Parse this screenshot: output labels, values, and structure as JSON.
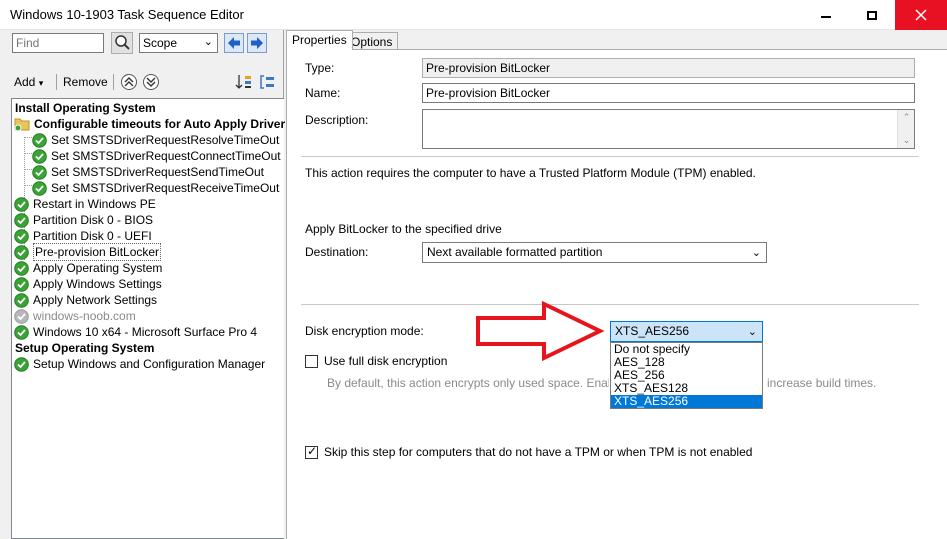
{
  "window": {
    "title": "Windows 10-1903 Task Sequence Editor"
  },
  "search": {
    "find_placeholder": "Find",
    "scope_value": "Scope"
  },
  "toolbar": {
    "add_label": "Add",
    "remove_label": "Remove"
  },
  "tree": {
    "items": [
      {
        "label": "Install Operating System",
        "style": "bold",
        "icon": "none"
      },
      {
        "label": "Configurable timeouts for Auto Apply Driver",
        "style": "bold",
        "icon": "folder"
      },
      {
        "label": "Set SMSTSDriverRequestResolveTimeOut",
        "style": "normal",
        "icon": "check"
      },
      {
        "label": "Set SMSTSDriverRequestConnectTimeOut",
        "style": "normal",
        "icon": "check"
      },
      {
        "label": "Set SMSTSDriverRequestSendTimeOut",
        "style": "normal",
        "icon": "check"
      },
      {
        "label": "Set SMSTSDriverRequestReceiveTimeOut",
        "style": "normal",
        "icon": "check"
      },
      {
        "label": "Restart in Windows PE",
        "style": "normal",
        "icon": "check"
      },
      {
        "label": "Partition Disk 0 - BIOS",
        "style": "normal",
        "icon": "check"
      },
      {
        "label": "Partition Disk 0 - UEFI",
        "style": "normal",
        "icon": "check"
      },
      {
        "label": "Pre-provision BitLocker",
        "style": "selected",
        "icon": "check"
      },
      {
        "label": "Apply Operating System",
        "style": "normal",
        "icon": "check"
      },
      {
        "label": "Apply Windows Settings",
        "style": "normal",
        "icon": "check"
      },
      {
        "label": "Apply Network Settings",
        "style": "normal",
        "icon": "check"
      },
      {
        "label": "windows-noob.com",
        "style": "disabled",
        "icon": "check-gray"
      },
      {
        "label": "Windows 10 x64 - Microsoft Surface Pro 4",
        "style": "normal",
        "icon": "check"
      },
      {
        "label": "Setup Operating System",
        "style": "bold",
        "icon": "none"
      },
      {
        "label": "Setup Windows and Configuration Manager",
        "style": "normal",
        "icon": "check"
      }
    ]
  },
  "tabs": [
    {
      "label": "Properties"
    },
    {
      "label": "Options"
    }
  ],
  "properties": {
    "type_label": "Type:",
    "type_value": "Pre-provision BitLocker",
    "name_label": "Name:",
    "name_value": "Pre-provision BitLocker",
    "description_label": "Description:",
    "description_value": "",
    "tpm_note": "This action requires the computer to have a Trusted Platform Module (TPM) enabled.",
    "apply_heading": "Apply BitLocker to the specified drive",
    "destination_label": "Destination:",
    "destination_value": "Next available formatted partition",
    "encryption_label": "Disk encryption mode:",
    "encryption_value": "XTS_AES256",
    "encryption_options": [
      "Do not specify",
      "AES_128",
      "AES_256",
      "XTS_AES128",
      "XTS_AES256"
    ],
    "encryption_selected_index": 4,
    "full_disk_label": "Use full disk encryption",
    "full_disk_checked": false,
    "full_disk_help_left": "By default, this action encrypts only used space. Enabling fu",
    "full_disk_help_right": "increase build times.",
    "skip_label": "Skip this step for computers that do not have a TPM or when TPM is not enabled",
    "skip_checked": true
  },
  "colors": {
    "arrow": "#e8141c",
    "selection": "#0078d7",
    "check_green": "#3aa335"
  }
}
